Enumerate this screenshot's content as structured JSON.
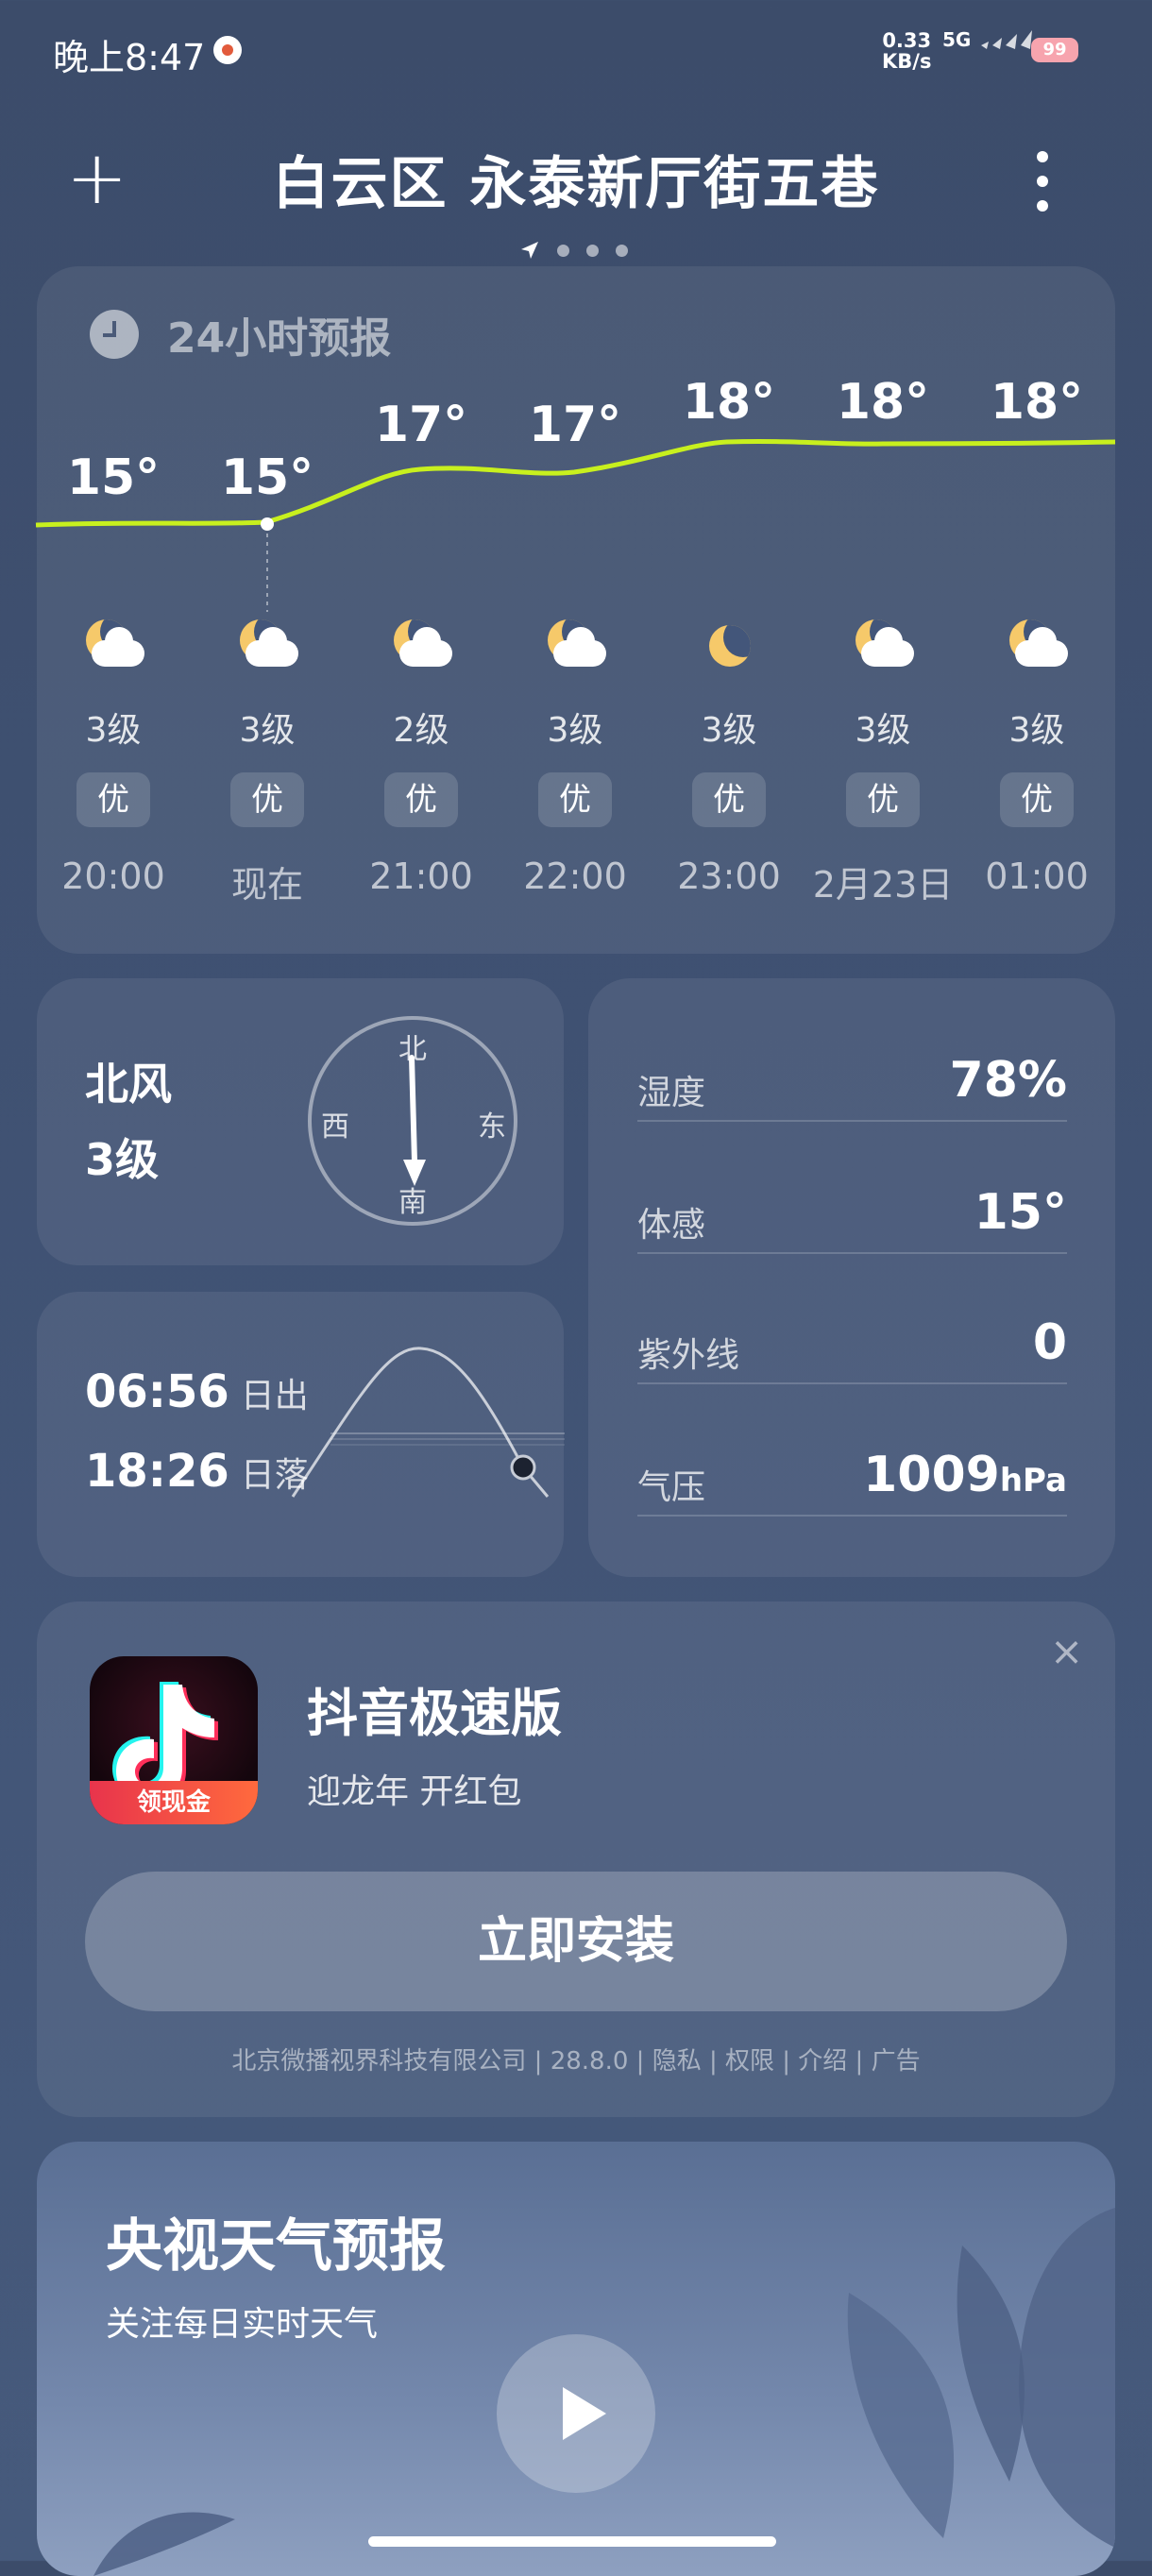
{
  "status_bar": {
    "time": "晚上8:47",
    "net_speed_value": "0.33",
    "net_speed_unit": "KB/s",
    "signal": "5G",
    "battery": "99"
  },
  "header": {
    "location": "白云区 永泰新厅街五巷"
  },
  "forecast": {
    "title": "24小时预报",
    "hours": [
      {
        "temp": "15°",
        "wind": "3级",
        "aqi": "优",
        "time": "20:00",
        "icon": "cloudy-night-icon"
      },
      {
        "temp": "15°",
        "wind": "3级",
        "aqi": "优",
        "time": "现在",
        "icon": "cloudy-night-icon"
      },
      {
        "temp": "17°",
        "wind": "2级",
        "aqi": "优",
        "time": "21:00",
        "icon": "cloudy-night-icon"
      },
      {
        "temp": "17°",
        "wind": "3级",
        "aqi": "优",
        "time": "22:00",
        "icon": "cloudy-night-icon"
      },
      {
        "temp": "18°",
        "wind": "3级",
        "aqi": "优",
        "time": "23:00",
        "icon": "clear-night-icon"
      },
      {
        "temp": "18°",
        "wind": "3级",
        "aqi": "优",
        "time": "2月23日",
        "icon": "cloudy-night-icon"
      },
      {
        "temp": "18°",
        "wind": "3级",
        "aqi": "优",
        "time": "01:00",
        "icon": "cloudy-night-icon"
      }
    ]
  },
  "wind": {
    "direction": "北风",
    "level": "3级",
    "compass": {
      "north": "北",
      "south": "南",
      "west": "西",
      "east": "东"
    }
  },
  "details": {
    "humidity": {
      "label": "湿度",
      "value": "78%"
    },
    "feels_like": {
      "label": "体感",
      "value": "15°"
    },
    "uv": {
      "label": "紫外线",
      "value": "0"
    },
    "pressure": {
      "label": "气压",
      "value": "1009",
      "unit": "hPa"
    }
  },
  "sun": {
    "sunrise": "06:56",
    "sunrise_label": "日出",
    "sunset": "18:26",
    "sunset_label": "日落"
  },
  "ad": {
    "app_name": "抖音极速版",
    "subtitle": "迎龙年 开红包",
    "badge": "领现金",
    "install_label": "立即安装",
    "footer": "北京微播视界科技有限公司 | 28.8.0 | 隐私 | 权限 | 介绍 | 广告"
  },
  "video": {
    "title": "央视天气预报",
    "subtitle": "关注每日实时天气"
  },
  "colors": {
    "temp_line": "#c8f01e",
    "background": "#3f5172"
  }
}
